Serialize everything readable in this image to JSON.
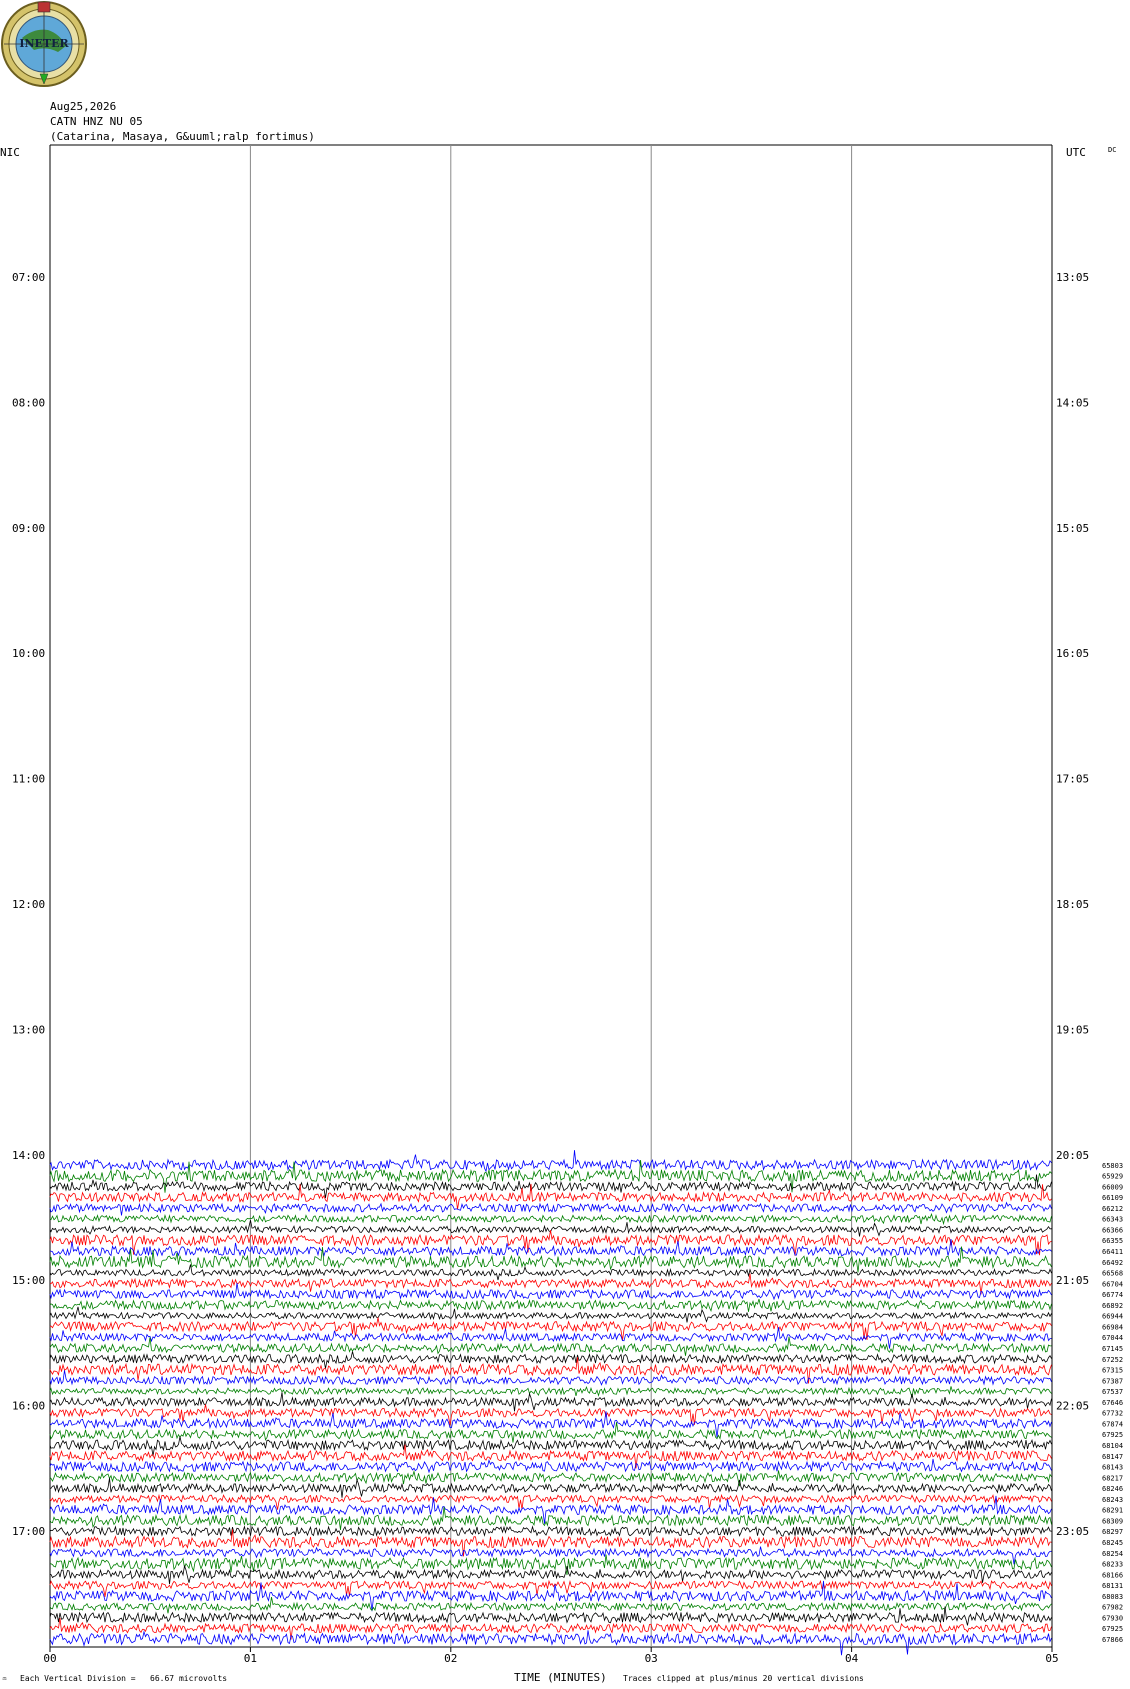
{
  "header": {
    "logo_text": "INETER",
    "date": "Aug25,2026",
    "station": "CATN HNZ NU 05",
    "location": "(Catarina, Masaya, G&uuml;ralp fortimus)",
    "left_zone": "NIC",
    "right_zone": "UTC",
    "dc_label": "DC"
  },
  "footer": {
    "scale_text": "Each Vertical Division =   66.67 microvolts",
    "xlabel": "TIME (MINUTES)",
    "clip_text": "Traces clipped at plus/minus 20 vertical divisions",
    "corner_mark": "♒"
  },
  "colors": {
    "traces": [
      "#0000ff",
      "#008000",
      "#000000",
      "#ff0000"
    ],
    "grid": "#888888",
    "frame": "#000000"
  },
  "chart_data": {
    "type": "line",
    "title": "",
    "xlabel": "TIME (MINUTES)",
    "xlim": [
      0,
      5
    ],
    "x_ticks": [
      "00",
      "01",
      "02",
      "03",
      "04",
      "05"
    ],
    "left_time_labels": [
      "07:00",
      "08:00",
      "09:00",
      "10:00",
      "11:00",
      "12:00",
      "13:00",
      "14:00",
      "15:00",
      "16:00",
      "17:00"
    ],
    "right_time_labels": [
      "13:05",
      "14:05",
      "15:05",
      "16:05",
      "17:05",
      "18:05",
      "19:05",
      "20:05",
      "21:05",
      "22:05",
      "23:05"
    ],
    "trace_start_time": "14:05",
    "trace_interval_minutes": 5,
    "trace_color_cycle": [
      "blue",
      "green",
      "black",
      "red"
    ],
    "trace_levels": [
      65803,
      65929,
      66009,
      66109,
      66212,
      66343,
      66366,
      66355,
      66411,
      66492,
      66568,
      66704,
      66774,
      66892,
      66944,
      66984,
      67044,
      67145,
      67252,
      67315,
      67387,
      67537,
      67646,
      67732,
      67874,
      67925,
      68104,
      68147,
      68143,
      68217,
      68246,
      68243,
      68291,
      68309,
      68297,
      68245,
      68254,
      68233,
      68166,
      68131,
      68083,
      67982,
      67930,
      67925,
      67866
    ],
    "grid": true
  }
}
